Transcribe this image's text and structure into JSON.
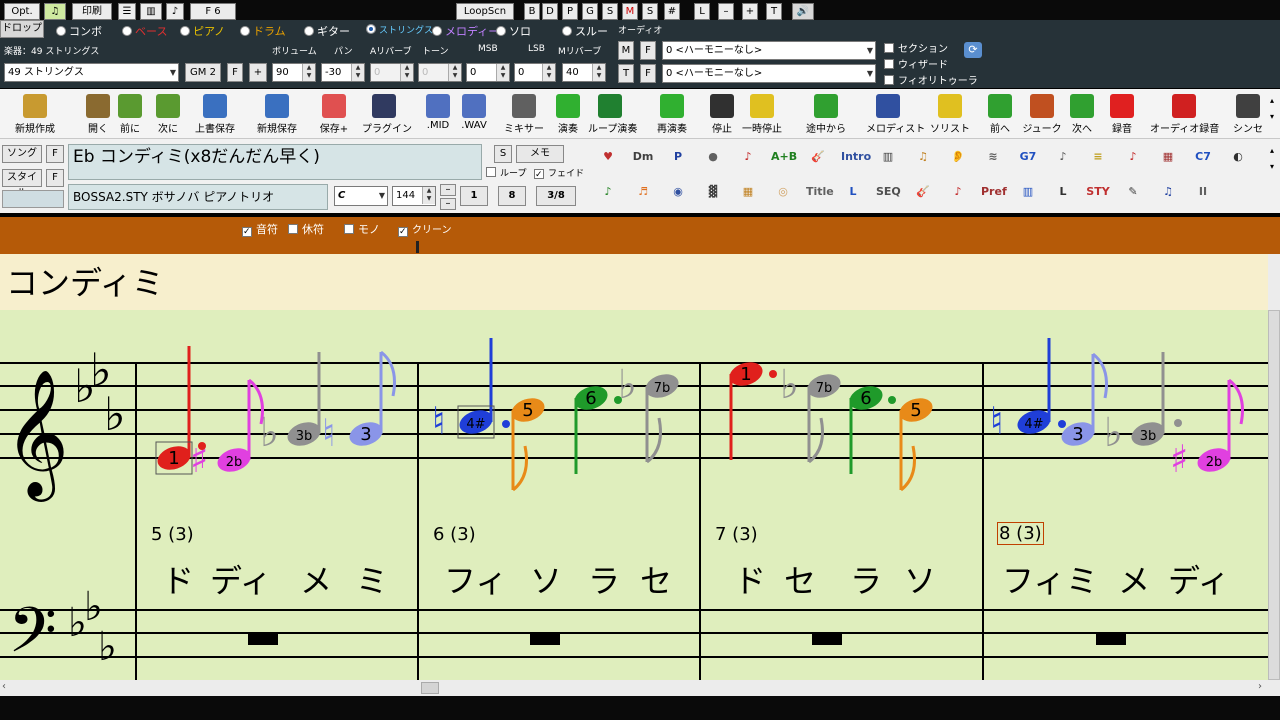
{
  "instruments": [
    {
      "label": "ドロップ",
      "selected": false
    },
    {
      "label": "コンボ",
      "selected": false
    },
    {
      "label": "ベース",
      "selected": false
    },
    {
      "label": "ピアノ",
      "selected": false
    },
    {
      "label": "ドラム",
      "selected": false
    },
    {
      "label": "ギター",
      "selected": false
    },
    {
      "label": "ストリングス",
      "selected": true
    },
    {
      "label": "メロディー",
      "selected": false
    },
    {
      "label": "ソロ",
      "selected": false
    },
    {
      "label": "スルー",
      "selected": false
    }
  ],
  "mixer": {
    "instrument_label": "楽器：49 ストリングス",
    "instrument_value": "49 ストリングス",
    "gm_button": "GM 2",
    "f_button": "F",
    "plus_button": "+",
    "headers": [
      "ボリューム",
      "パン",
      "Aリバーブ",
      "トーン",
      "MSB",
      "LSB",
      "Mリバーブ"
    ],
    "values": [
      "90",
      "-30",
      "0",
      "0",
      "0",
      "0",
      "40"
    ]
  },
  "audio": {
    "title": "オーディオ",
    "m": "M",
    "t": "T",
    "f": "F",
    "harmony1": "0 <ハーモニーなし>",
    "harmony2": "0 <ハーモニーなし>",
    "options": [
      "セクション",
      "ウィザード",
      "フィオリトゥーラ"
    ]
  },
  "toolbar": [
    "新規作成",
    "開く",
    "前に",
    "次に",
    "上書保存",
    "新規保存",
    "保存+",
    "プラグイン",
    ".MID",
    ".WAV",
    "ミキサー",
    "演奏",
    "ループ演奏",
    "再演奏",
    "停止",
    "一時停止",
    "途中から",
    "メロディスト",
    "ソリスト",
    "前へ",
    "ジューク",
    "次へ",
    "録音",
    "オーディオ録音",
    "シンセ"
  ],
  "song": {
    "song_btn": "ソング",
    "style_btn": "スタイル",
    "f": "F",
    "title": "Eb コンディミ(x8だんだん早く)",
    "style": "BOSSA2.STY ボサノバ ピアノトリオ",
    "s_btn": "S",
    "memo_btn": "メモ",
    "loop_label": "ループ",
    "fade_label": "フェイド",
    "key": "C",
    "tempo": "144",
    "b1": "1",
    "b8": "8",
    "time": "3/8"
  },
  "palette": {
    "row1": [
      "♥",
      "Dm",
      "P",
      "●",
      "♪",
      "A+B",
      "🎸",
      "Intro",
      "▥",
      "♫",
      "👂",
      "≋",
      "G7",
      "♪",
      "≡",
      "♪",
      "▦",
      "C7",
      "◐"
    ],
    "row2": [
      "♪",
      "♬",
      "◉",
      "▓",
      "▦",
      "◎",
      "Title",
      "L",
      "SEQ",
      "🎸",
      "♪",
      "Pref",
      "▥",
      "L",
      "STY",
      "✎",
      "♫",
      "II"
    ]
  },
  "notation_bar": {
    "opt": "Opt.",
    "print": "印刷",
    "position": "F 6",
    "note_label": "音符",
    "rest_label": "休符",
    "mono_label": "モノ",
    "clean_label": "クリーン",
    "loopscn": "LoopScn",
    "letters": [
      "B",
      "D",
      "P",
      "G",
      "S",
      "M",
      "S",
      "#",
      "L",
      "–",
      "+",
      "T"
    ]
  },
  "score": {
    "section_title": "コンディミ",
    "measures": [
      {
        "label": "5 (3)",
        "lyrics": [
          "ド",
          "ディ",
          "メ",
          "ミ"
        ]
      },
      {
        "label": "6 (3)",
        "lyrics": [
          "フィ",
          "ソ",
          "ラ",
          "セ"
        ]
      },
      {
        "label": "7 (3)",
        "lyrics": [
          "ド",
          "セ",
          "ラ",
          "ソ"
        ]
      },
      {
        "label": "8 (3)",
        "lyrics": [
          "フィ",
          "ミ",
          "メ",
          "ディ"
        ]
      }
    ],
    "note_labels": [
      "1",
      "2b",
      "3b",
      "3",
      "4#",
      "5",
      "6",
      "7b",
      "1",
      "7b",
      "6",
      "5",
      "4#",
      "3",
      "3b",
      "2b"
    ],
    "colors": {
      "red": "#e0201c",
      "magenta": "#e040e0",
      "gray": "#909090",
      "blue": "#1f3ed8",
      "lightblue": "#8a95e8",
      "orange": "#e88a18",
      "green": "#1f9a2a"
    }
  }
}
